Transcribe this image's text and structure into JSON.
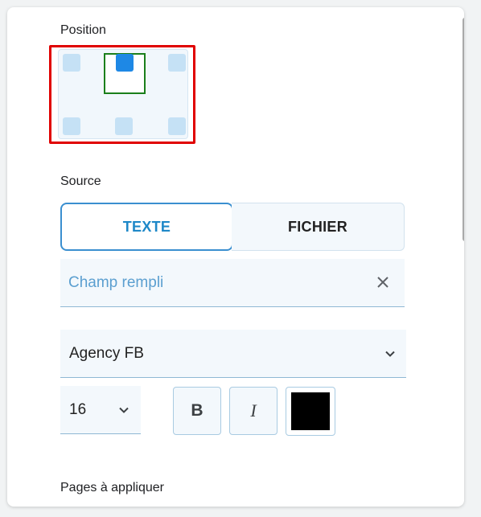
{
  "position": {
    "label": "Position",
    "selected": "top-center",
    "highlight_color": "#e00000"
  },
  "source": {
    "label": "Source",
    "options": [
      "TEXTE",
      "FICHIER"
    ],
    "selected": "TEXTE",
    "text_value": "Champ rempli"
  },
  "font": {
    "family_value": "Agency FB",
    "size_value": "16",
    "bold_label": "B",
    "italic_label": "I",
    "color": "#000000"
  },
  "pages": {
    "label": "Pages à appliquer"
  },
  "icons": {
    "clear": "close-icon",
    "dropdown": "chevron-down-icon"
  },
  "colors": {
    "accent": "#1e88c8",
    "selected_marker": "#1e88e5",
    "selected_frame": "#1b7f1b",
    "field_bg": "#f3f8fc"
  }
}
